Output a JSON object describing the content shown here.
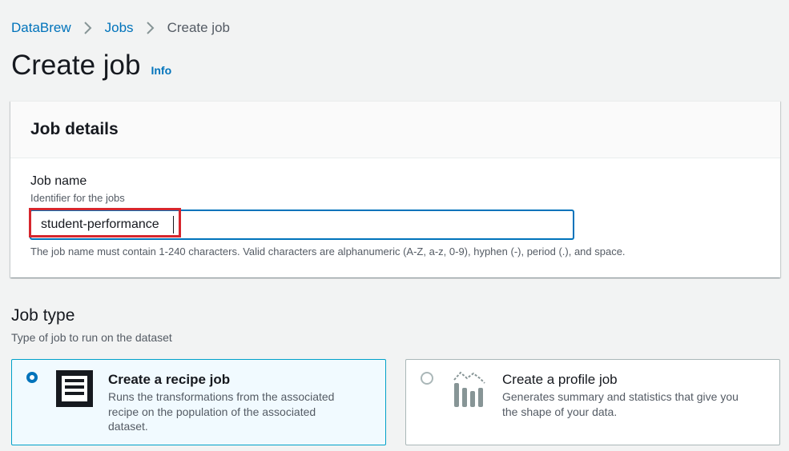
{
  "breadcrumb": {
    "items": [
      "DataBrew",
      "Jobs"
    ],
    "current": "Create job"
  },
  "header": {
    "title": "Create job",
    "info_label": "Info"
  },
  "job_details": {
    "title": "Job details",
    "job_name": {
      "label": "Job name",
      "description": "Identifier for the jobs",
      "value": "student-performance",
      "constraint": "The job name must contain 1-240 characters. Valid characters are alphanumeric (A-Z, a-z, 0-9), hyphen (-), period (.), and space."
    }
  },
  "job_type": {
    "title": "Job type",
    "description": "Type of job to run on the dataset",
    "options": [
      {
        "label": "Create a recipe job",
        "description": "Runs the transformations from the associated recipe on the population of the associated dataset.",
        "selected": true,
        "icon": "recipe-list-icon"
      },
      {
        "label": "Create a profile job",
        "description": "Generates summary and statistics that give you the shape of your data.",
        "selected": false,
        "icon": "profile-chart-icon"
      }
    ]
  },
  "colors": {
    "link": "#0073bb",
    "selected_tile_bg": "#f1faff",
    "selected_tile_border": "#00a1c9",
    "highlight": "#d6262d"
  }
}
